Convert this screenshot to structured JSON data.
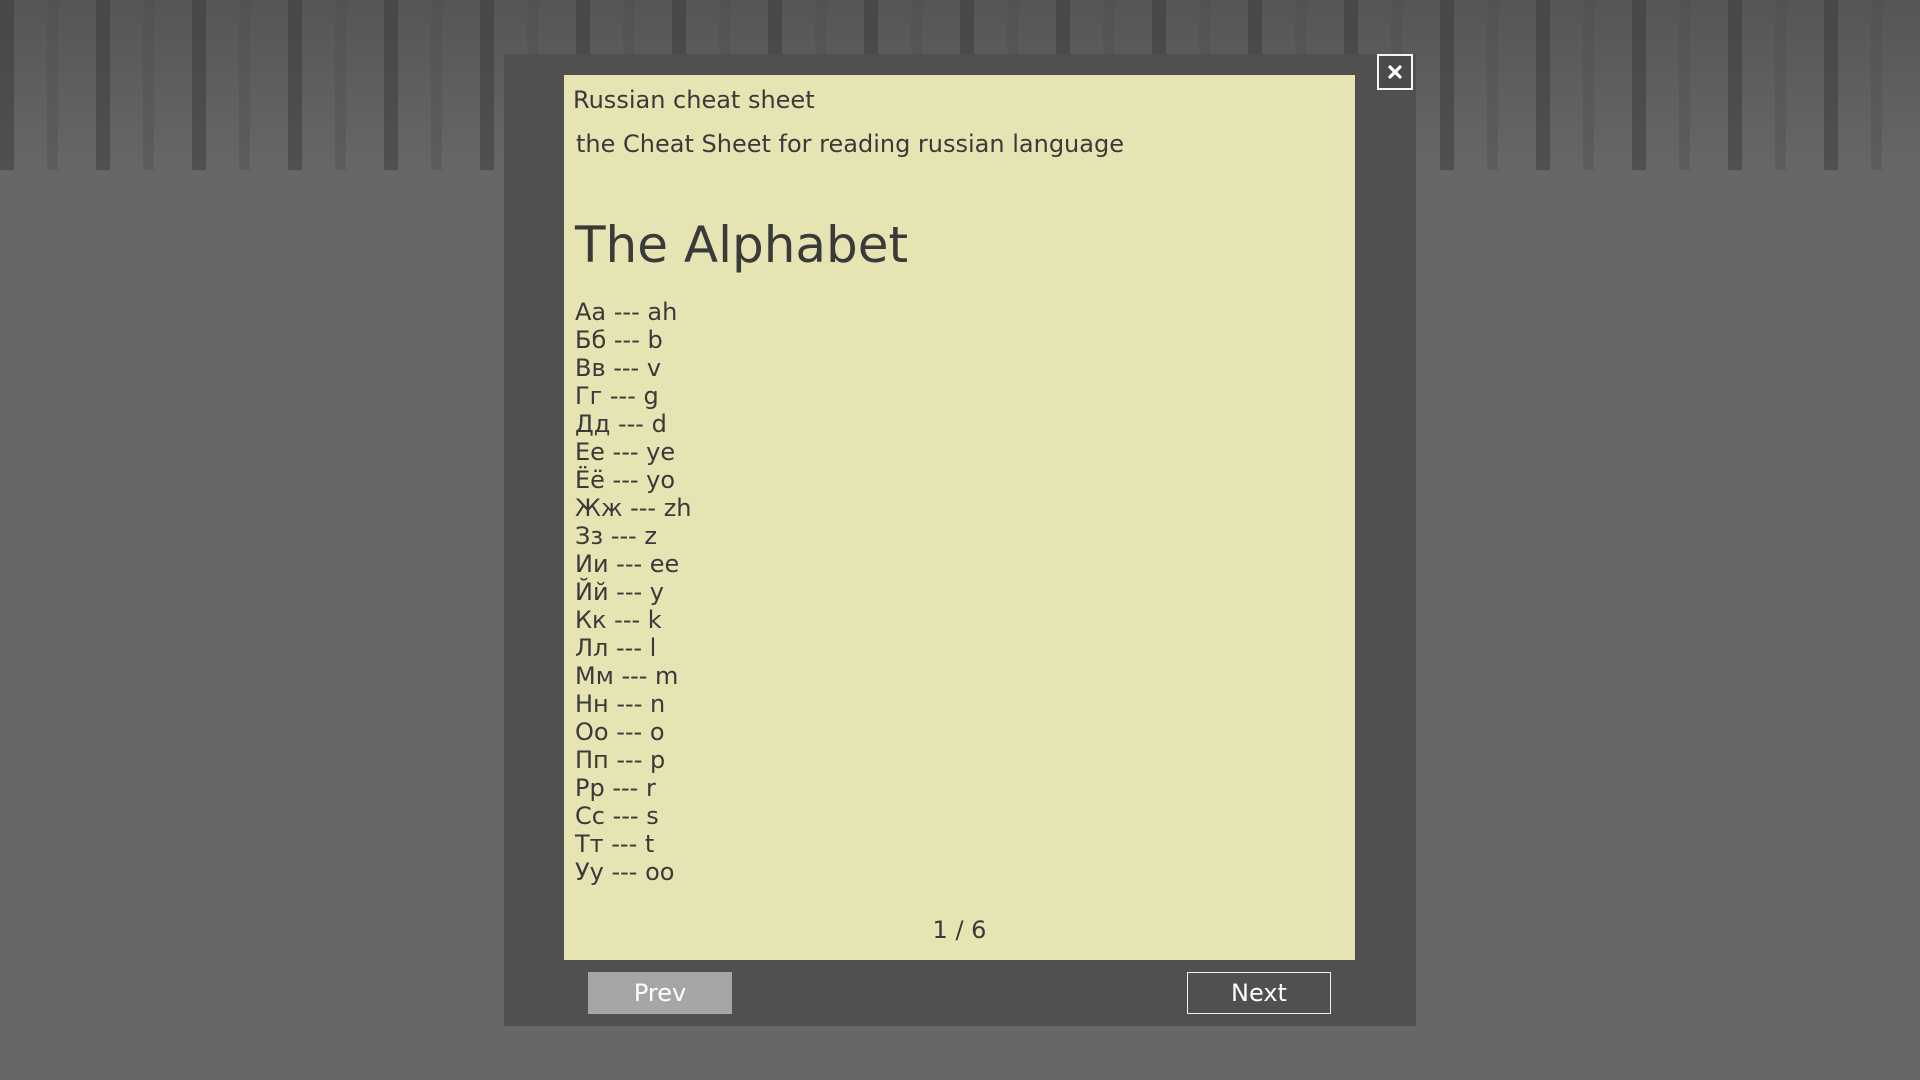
{
  "dialog": {
    "close_icon": "close-icon",
    "prev_label": "Prev",
    "next_label": "Next",
    "page_indicator": "1 / 6"
  },
  "document": {
    "title": "Russian cheat sheet",
    "subtitle": "the Cheat Sheet for reading russian language",
    "section_heading": "The Alphabet",
    "letters": [
      "Аа --- ah",
      "Бб --- b",
      "Вв --- v",
      "Гг --- g",
      "Дд --- d",
      "Ее --- ye",
      "Ёё --- yo",
      "Жж --- zh",
      "Зз --- z",
      "Ии --- ee",
      "Йй --- y",
      "Кк --- k",
      "Лл --- l",
      "Мм --- m",
      "Нн --- n",
      "Оо --- o",
      "Пп --- p",
      "Рр --- r",
      "Сс --- s",
      "Тт --- t",
      "Уу --- oo"
    ]
  },
  "colors": {
    "page_background": "#e7e4b4",
    "modal_frame": "#505050",
    "screen_background": "#676767",
    "text": "#3a3a3a",
    "prev_button_disabled": "#a6a6a6"
  }
}
